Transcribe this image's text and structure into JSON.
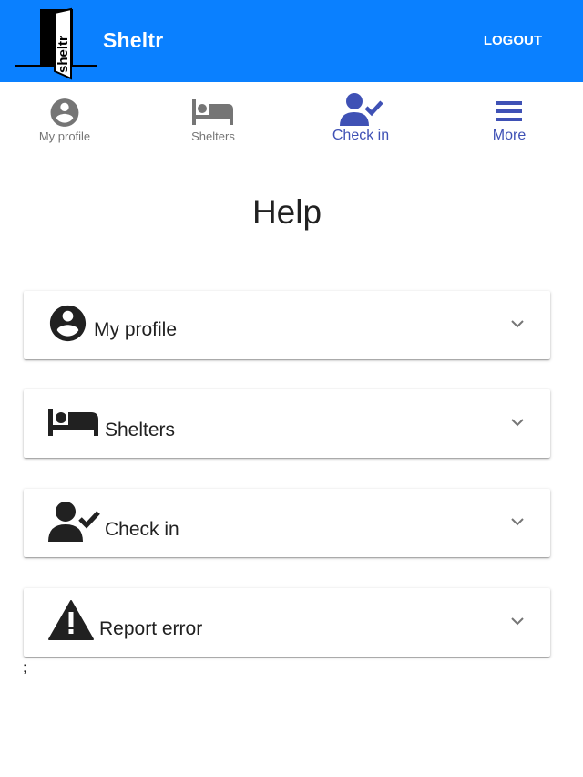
{
  "header": {
    "logo_text": "sheltr",
    "brand": "Sheltr",
    "logout_label": "LOGOUT",
    "background_color": "#0a80ff"
  },
  "nav": {
    "items": [
      {
        "label": "My profile",
        "icon": "account-circle-icon",
        "active": false
      },
      {
        "label": "Shelters",
        "icon": "bed-icon",
        "active": false
      },
      {
        "label": "Check in",
        "icon": "person-check-icon",
        "active": true
      },
      {
        "label": "More",
        "icon": "menu-icon",
        "active": true
      }
    ],
    "active_color": "#3f51b5",
    "inactive_color": "#757575"
  },
  "main": {
    "title": "Help",
    "panels": [
      {
        "label": "My profile",
        "icon": "account-circle-icon"
      },
      {
        "label": "Shelters",
        "icon": "bed-icon"
      },
      {
        "label": "Check in",
        "icon": "person-check-icon"
      },
      {
        "label": "Report error",
        "icon": "warning-icon"
      }
    ],
    "trailing_text": ";"
  }
}
